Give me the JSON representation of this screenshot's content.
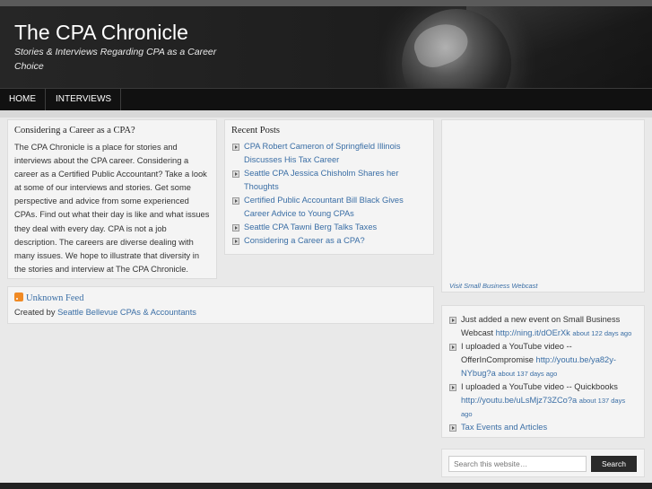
{
  "header": {
    "title": "The CPA Chronicle",
    "description": "Stories & Interviews Regarding CPA as a Career Choice"
  },
  "nav": {
    "items": [
      "HOME",
      "INTERVIEWS"
    ]
  },
  "about": {
    "title": "Considering a Career as a CPA?",
    "text": "The CPA Chronicle is a place for stories and interviews about the CPA career. Considering a career as a Certified Public Accountant? Take a look at some of our interviews and stories. Get some perspective and advice from some experienced CPAs. Find out what their day is like and what issues they deal with every day. CPA is not a job description. The careers are diverse dealing with many issues. We hope to illustrate that diversity in the stories and interview at The CPA Chronicle."
  },
  "recent_posts": {
    "title": "Recent Posts",
    "items": [
      "CPA Robert Cameron of Springfield Illinois Discusses His Tax Career",
      "Seattle CPA Jessica Chisholm Shares her Thoughts",
      "Certified Public Accountant Bill Black Gives Career Advice to Young CPAs",
      "Seattle CPA Tawni Berg Talks Taxes",
      "Considering a Career as a CPA?"
    ]
  },
  "feed": {
    "link": "Unknown Feed",
    "credit_prefix": "Created by",
    "credit_link": "Seattle Bellevue CPAs & Accountants"
  },
  "ad": {
    "link": "Visit Small Business Webcast"
  },
  "tweets": [
    {
      "text": "Just added a new event on Small Business Webcast",
      "link": "http://ning.it/dOErXk",
      "ago": "about 122 days ago"
    },
    {
      "text": "I uploaded a YouTube video -- OfferInCompromise",
      "link": "http://youtu.be/ya82y-NYbug?a",
      "ago": "about 137 days ago"
    },
    {
      "text": "I uploaded a YouTube video -- Quickbooks",
      "link": "http://youtu.be/uLsMjz73ZCo?a",
      "ago": "about 137 days ago"
    },
    {
      "text": "",
      "link": "Tax Events and Articles",
      "ago": ""
    }
  ],
  "search": {
    "placeholder": "Search this website…",
    "button": "Search"
  },
  "colors": {
    "link": "#3a6ea5",
    "header_bg": "#1e1e1e",
    "nav_bg": "#111111"
  }
}
